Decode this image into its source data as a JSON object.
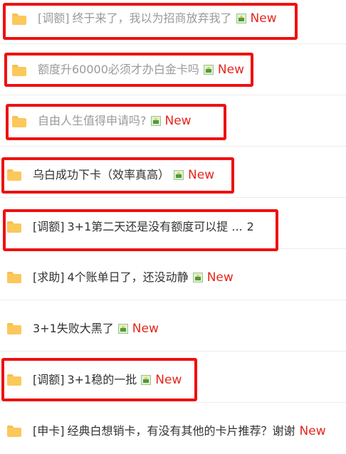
{
  "threads": [
    {
      "tag": "[调额]",
      "title": "终于来了，我以为招商放弃我了",
      "new": "New",
      "pages": ""
    },
    {
      "tag": "",
      "title": "额度升60000必须才办白金卡吗",
      "new": "New",
      "pages": ""
    },
    {
      "tag": "",
      "title": "自由人生值得申请吗?",
      "new": "New",
      "pages": ""
    },
    {
      "tag": "",
      "title": "乌白成功下卡（效率真高）",
      "new": "New",
      "pages": ""
    },
    {
      "tag": "[调额]",
      "title": "3+1第二天还是没有额度可以提 ...",
      "new": "",
      "pages": "2"
    },
    {
      "tag": "[求助]",
      "title": "4个账单日了，还没动静",
      "new": "New",
      "pages": ""
    },
    {
      "tag": "",
      "title": "3+1失败大黑了",
      "new": "New",
      "pages": ""
    },
    {
      "tag": "[调额]",
      "title": "3+1稳的一批",
      "new": "New",
      "pages": ""
    },
    {
      "tag": "[申卡]",
      "title": "经典白想销卡，有没有其他的卡片推荐？谢谢",
      "new": "New",
      "pages": ""
    }
  ],
  "colors": {
    "highlight_box": "#ee1111",
    "new_badge": "#e5271c",
    "folder": "#fbc85b",
    "visited_text": "#9a9a9a",
    "normal_text": "#333333"
  }
}
